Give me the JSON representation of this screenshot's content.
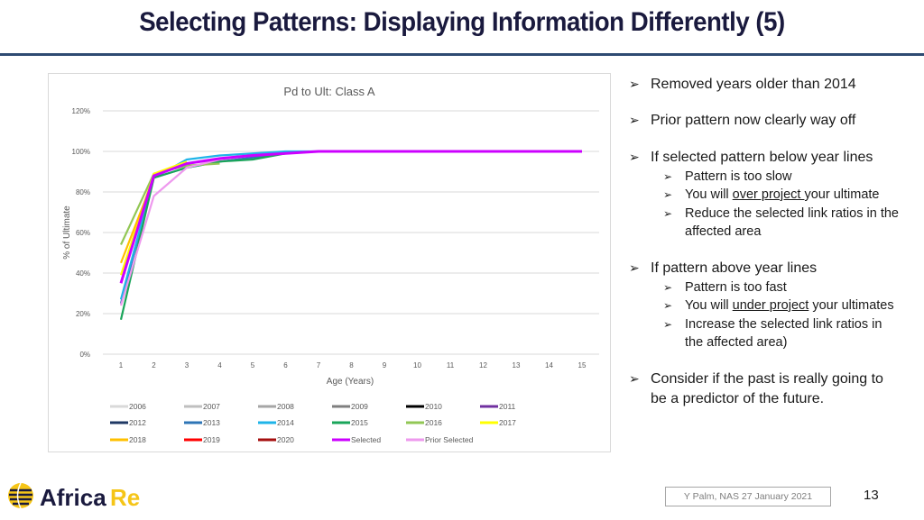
{
  "header": {
    "title": "Selecting Patterns: Displaying Information Differently (5)"
  },
  "bullets": {
    "b1": "Removed years older than 2014",
    "b2": "Prior pattern now clearly way off",
    "b3": "If selected pattern below year lines",
    "b3_sub1": "Pattern is too slow",
    "b3_sub2_pre": "You will ",
    "b3_sub2_u": "over project ",
    "b3_sub2_post": "your ultimate",
    "b3_sub3_l1": "Reduce the selected link ratios in the",
    "b3_sub3_l2": "affected area",
    "b4": "If pattern above year lines",
    "b4_sub1": "Pattern is too fast",
    "b4_sub2_pre": "You will ",
    "b4_sub2_u": "under project",
    "b4_sub2_post": " your ultimates",
    "b4_sub3_l1": "Increase the selected link ratios in",
    "b4_sub3_l2": "the affected area)",
    "b5_l1": "Consider if the past is really going to",
    "b5_l2": "be a predictor of the future.",
    "arrow": "➢"
  },
  "footer": {
    "logo_text_1": "Africa",
    "logo_text_2": "Re",
    "presenter": "Y Palm, NAS 27 January 2021",
    "page_number": "13"
  },
  "chart_data": {
    "type": "line",
    "title": "Pd to Ult: Class A",
    "xlabel": "Age (Years)",
    "ylabel": "% of Ultimate",
    "x": [
      1,
      2,
      3,
      4,
      5,
      6,
      7,
      8,
      9,
      10,
      11,
      12,
      13,
      14,
      15
    ],
    "ylim": [
      0,
      1.2
    ],
    "yticks": [
      0,
      0.2,
      0.4,
      0.6,
      0.8,
      1.0,
      1.2
    ],
    "ytick_labels": [
      "0%",
      "20%",
      "40%",
      "60%",
      "80%",
      "100%",
      "120%"
    ],
    "grid": true,
    "legend_position": "bottom",
    "legend": [
      {
        "name": "2006",
        "color": "#d9d9d9"
      },
      {
        "name": "2007",
        "color": "#bfbfbf"
      },
      {
        "name": "2008",
        "color": "#a6a6a6"
      },
      {
        "name": "2009",
        "color": "#7f7f7f"
      },
      {
        "name": "2010",
        "color": "#000000"
      },
      {
        "name": "2011",
        "color": "#7030a0"
      },
      {
        "name": "2012",
        "color": "#1f3864"
      },
      {
        "name": "2013",
        "color": "#2e75b6"
      },
      {
        "name": "2014",
        "color": "#1fb4e8"
      },
      {
        "name": "2015",
        "color": "#1aa55a"
      },
      {
        "name": "2016",
        "color": "#92c755"
      },
      {
        "name": "2017",
        "color": "#ffff00"
      },
      {
        "name": "2018",
        "color": "#ffc000"
      },
      {
        "name": "2019",
        "color": "#ff0000"
      },
      {
        "name": "2020",
        "color": "#a50f0f"
      },
      {
        "name": "Selected",
        "color": "#cc00ff"
      },
      {
        "name": "Prior Selected",
        "color": "#ee99ee"
      }
    ],
    "series": [
      {
        "name": "2013",
        "color": "#2e75b6",
        "values": [
          0.25,
          0.87,
          0.92,
          0.95,
          0.97,
          0.99,
          1.0,
          1.0
        ]
      },
      {
        "name": "2014",
        "color": "#1fb4e8",
        "values": [
          0.27,
          0.87,
          0.96,
          0.98,
          0.99,
          1.0,
          1.0
        ]
      },
      {
        "name": "2015",
        "color": "#1aa55a",
        "values": [
          0.17,
          0.87,
          0.92,
          0.95,
          0.96,
          0.99
        ]
      },
      {
        "name": "2016",
        "color": "#92c755",
        "values": [
          0.54,
          0.89,
          0.93,
          0.94
        ]
      },
      {
        "name": "2017",
        "color": "#ffff00",
        "values": [
          0.39,
          0.89,
          0.95
        ]
      },
      {
        "name": "2018",
        "color": "#ffc000",
        "values": [
          0.45,
          0.87
        ]
      },
      {
        "name": "2019",
        "color": "#ff0000",
        "values": [
          0.37
        ]
      },
      {
        "name": "Prior Selected",
        "color": "#ee99ee",
        "values": [
          0.24,
          0.78,
          0.92,
          0.96,
          0.98,
          0.99,
          1.0,
          1.0,
          1.0,
          1.0,
          1.0,
          1.0,
          1.0,
          1.0,
          1.0
        ]
      },
      {
        "name": "Selected",
        "color": "#cc00ff",
        "values": [
          0.35,
          0.88,
          0.94,
          0.965,
          0.98,
          0.99,
          1.0,
          1.0,
          1.0,
          1.0,
          1.0,
          1.0,
          1.0,
          1.0,
          1.0
        ]
      }
    ]
  }
}
